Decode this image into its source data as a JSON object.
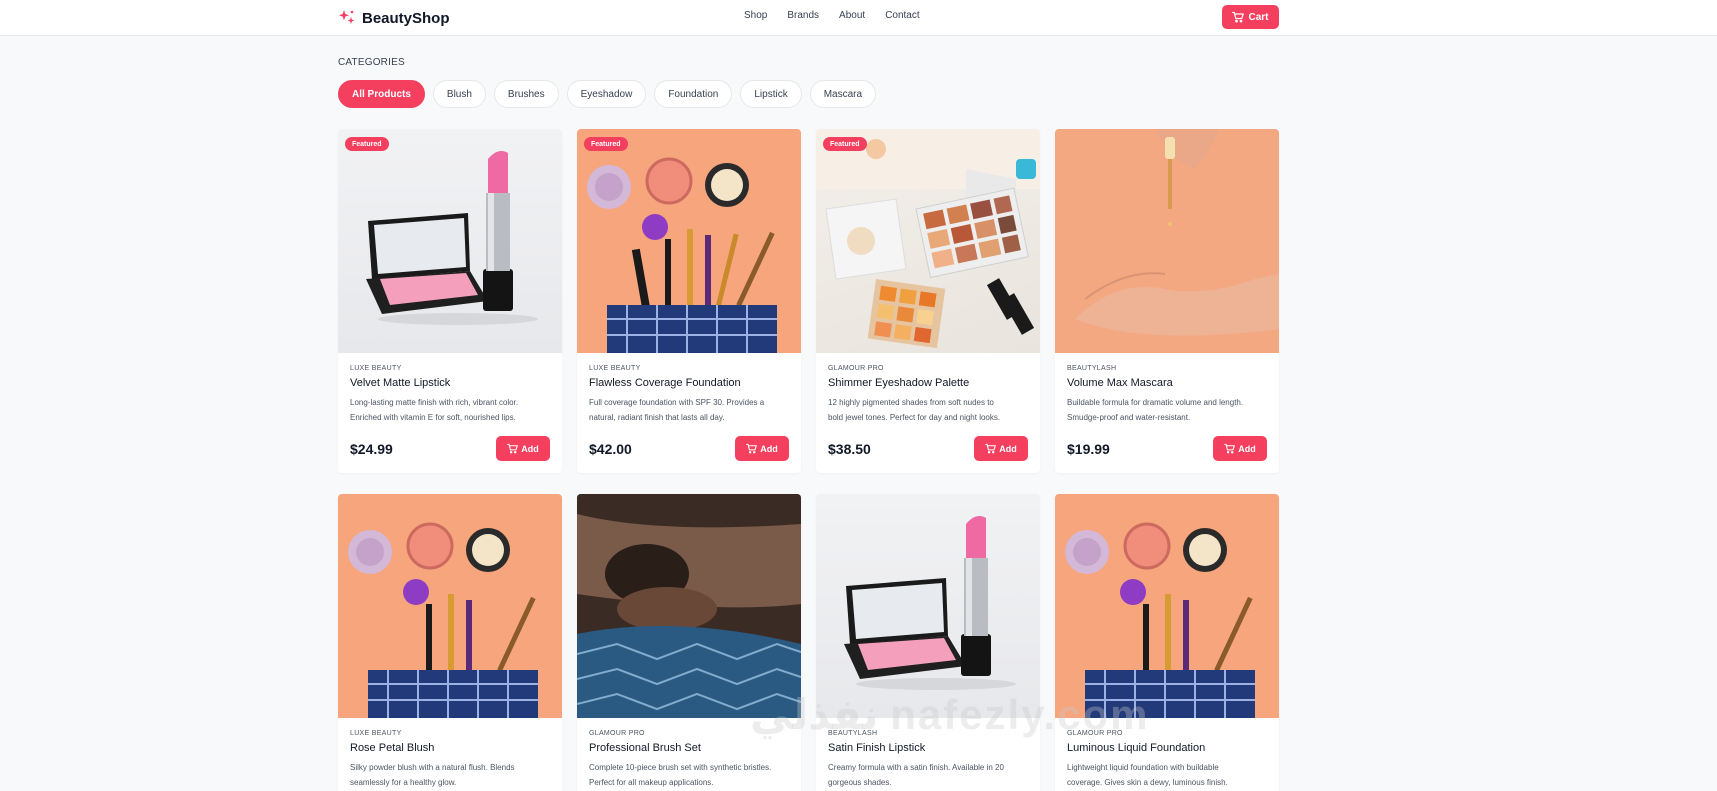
{
  "header": {
    "logo_text": "BeautyShop",
    "nav": [
      "Shop",
      "Brands",
      "About",
      "Contact"
    ],
    "cart_label": "Cart"
  },
  "categories": {
    "heading": "CATEGORIES",
    "items": [
      "All Products",
      "Blush",
      "Brushes",
      "Eyeshadow",
      "Foundation",
      "Lipstick",
      "Mascara"
    ],
    "selected": "All Products"
  },
  "products": [
    {
      "brand": "LUXE BEAUTY",
      "name": "Velvet Matte Lipstick",
      "desc1": "Long-lasting matte finish with rich, vibrant color.",
      "desc2": "Enriched with vitamin E for soft, nourished lips.",
      "price": "$24.99",
      "badge": "Featured",
      "add": "Add"
    },
    {
      "brand": "LUXE BEAUTY",
      "name": "Flawless Coverage Foundation",
      "desc1": "Full coverage foundation with SPF 30. Provides a",
      "desc2": "natural, radiant finish that lasts all day.",
      "price": "$42.00",
      "badge": "Featured",
      "add": "Add"
    },
    {
      "brand": "GLAMOUR PRO",
      "name": "Shimmer Eyeshadow Palette",
      "desc1": "12 highly pigmented shades from soft nudes to",
      "desc2": "bold jewel tones. Perfect for day and night looks.",
      "price": "$38.50",
      "badge": "Featured",
      "add": "Add"
    },
    {
      "brand": "BEAUTYLASH",
      "name": "Volume Max Mascara",
      "desc1": "Buildable formula for dramatic volume and length.",
      "desc2": "Smudge-proof and water-resistant.",
      "price": "$19.99",
      "badge": "",
      "add": "Add"
    },
    {
      "brand": "LUXE BEAUTY",
      "name": "Rose Petal Blush",
      "desc1": "Silky powder blush with a natural flush. Blends",
      "desc2": "seamlessly for a healthy glow.",
      "price": "",
      "badge": "",
      "add": ""
    },
    {
      "brand": "GLAMOUR PRO",
      "name": "Professional Brush Set",
      "desc1": "Complete 10-piece brush set with synthetic bristles.",
      "desc2": "Perfect for all makeup applications.",
      "price": "",
      "badge": "",
      "add": ""
    },
    {
      "brand": "BEAUTYLASH",
      "name": "Satin Finish Lipstick",
      "desc1": "Creamy formula with a satin finish. Available in 20",
      "desc2": "gorgeous shades.",
      "price": "",
      "badge": "",
      "add": ""
    },
    {
      "brand": "GLAMOUR PRO",
      "name": "Luminous Liquid Foundation",
      "desc1": "Lightweight liquid foundation with buildable",
      "desc2": "coverage. Gives skin a dewy, luminous finish.",
      "price": "",
      "badge": "",
      "add": ""
    }
  ],
  "watermark": "نفذلي nafezly.com",
  "colors": {
    "accent": "#f43f5e",
    "background": "#f8f9fb"
  }
}
